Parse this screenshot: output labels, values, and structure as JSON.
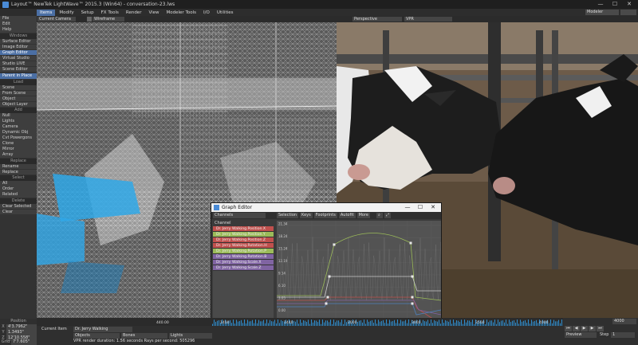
{
  "window": {
    "title": "Layout™ NewTek LightWave™ 2015.3 (Win64) - conversation-23.lws",
    "controls": [
      "—",
      "☐",
      "✕"
    ]
  },
  "menu": {
    "file": "File",
    "edit": "Edit",
    "help": "Help",
    "tabs": [
      "Items",
      "Modify",
      "Setup",
      "FX Tools",
      "Render",
      "View",
      "Modeler Tools",
      "I/O",
      "Utilities"
    ],
    "active_tab": "Items",
    "modeler_dropdown": "Modeler"
  },
  "left_panel": {
    "windows_head": "Windows",
    "windows": [
      "Surface Editor",
      "Image Editor",
      "Graph Editor",
      "Virtual Studio",
      "Studio LIVE",
      "Scene Editor"
    ],
    "parent_in_place": "Parent in Place",
    "load_head": "Load",
    "load": [
      "Scene",
      "From Scene",
      "Object",
      "Object Layer"
    ],
    "add_head": "Add",
    "add": [
      "Null",
      "Lights",
      "Camera",
      "Dynamic Obj",
      "Cvt Powergons",
      "Clone",
      "Mirror",
      "Array"
    ],
    "replace_head": "Replace",
    "replace": [
      "Rename",
      "Replace"
    ],
    "delete_head": "Delete",
    "delete": [
      "Clear Selected",
      "Clear"
    ],
    "select_head": "Select",
    "select": [
      "All",
      "Order",
      "Related"
    ]
  },
  "viewport_left": {
    "camera": "Current Camera",
    "mode": "Wireframe"
  },
  "viewport_right": {
    "view": "Perspective",
    "mode": "VPR"
  },
  "graph_editor": {
    "title": "Graph Editor",
    "channels_dropdown": "Channels",
    "toolbar": [
      "Selection",
      "Keys",
      "Footprints",
      "Autofit",
      "More"
    ],
    "channel_head": "Channel",
    "channels": [
      {
        "name": "Dr. Jerry Walking.Position.X",
        "color": "#c0504d"
      },
      {
        "name": "Dr. Jerry Walking.Position.Y",
        "color": "#9bbb59"
      },
      {
        "name": "Dr. Jerry Walking.Position.Z",
        "color": "#c0504d"
      },
      {
        "name": "Dr. Jerry Walking.Rotation.H",
        "color": "#c0504d"
      },
      {
        "name": "Dr. Jerry Walking.Rotation.P",
        "color": "#9bbb59"
      },
      {
        "name": "Dr. Jerry Walking.Rotation.B",
        "color": "#8064a2"
      },
      {
        "name": "Dr. Jerry Walking.Scale.X",
        "color": "#8064a2"
      },
      {
        "name": "Dr. Jerry Walking.Scale.Z",
        "color": "#8064a2"
      }
    ],
    "y_labels": [
      "21.34",
      "18.24",
      "15.24",
      "12.19",
      "9.14",
      "6.10",
      "3.05",
      "0.00",
      "-3.05"
    ],
    "x_labels": [
      "1400",
      "1600",
      "1800",
      "2000",
      "2200",
      "2400",
      "2600"
    ],
    "bottom_hint": "LMB - Move Values, Ctrl+LMB - Move Time, Ctrl+RMB-Drag Cop...",
    "bottom_mode": "Move"
  },
  "position": {
    "label": "Position",
    "x": "4'3.7962\"",
    "y": "1.3493\"",
    "z": "12'10.558\"",
    "grid_label": "Grid",
    "grid": "7'7.605\""
  },
  "timeline": {
    "ticks": [
      "440.00",
      "1400",
      "1440",
      "2000",
      "3000",
      "3500",
      "4000"
    ],
    "end_frame": "4000"
  },
  "bottom": {
    "current_item_label": "Current Item",
    "current_item": "Dr. Jerry Walking",
    "objects": "Objects",
    "bones": "Bones",
    "lights": "Lights",
    "cameras": "Cameras",
    "render_status": "VPR render duration: 1.56 seconds  Rays per second: 505296",
    "preview": "Preview",
    "step_label": "Step",
    "step": "1"
  }
}
